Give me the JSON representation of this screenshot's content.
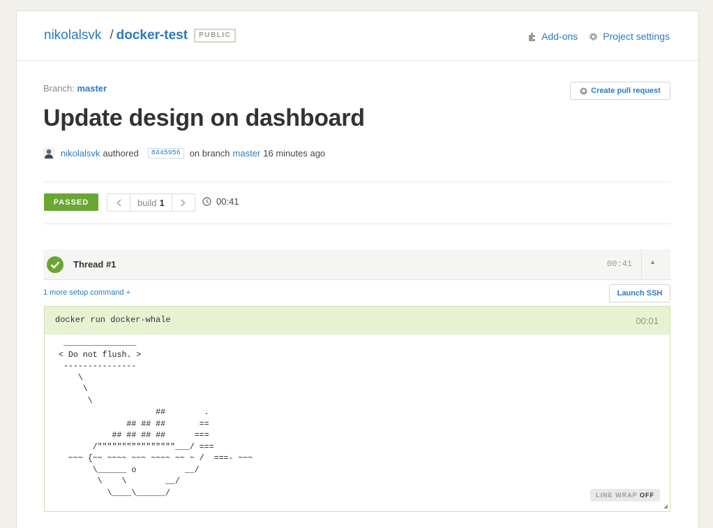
{
  "header": {
    "owner": "nikolalsvk",
    "separator": "/",
    "repo": "docker-test",
    "visibility": "PUBLIC",
    "links": {
      "addons": "Add-ons",
      "settings": "Project settings"
    }
  },
  "build": {
    "branch_label": "Branch:",
    "branch": "master",
    "create_pr": "Create pull request",
    "title": "Update design on dashboard",
    "author": "nikolalsvk",
    "authored": "authored",
    "sha": "8445956",
    "on_branch": "on branch",
    "branch_link": "master",
    "time_ago": "16 minutes ago",
    "status": "PASSED",
    "build_word": "build",
    "build_number": "1",
    "duration": "00:41"
  },
  "thread": {
    "name": "Thread #1",
    "time": "00:41",
    "setup_link": "1 more setup command +",
    "launch_ssh": "Launch SSH"
  },
  "command": {
    "text": "docker run docker-whale",
    "time": "00:01",
    "output": " _______________\n< Do not flush. >\n ---------------\n    \\\n     \\\n      \\\n                    ##        .\n              ## ## ##       ==\n           ## ## ## ##      ===\n       /\"\"\"\"\"\"\"\"\"\"\"\"\"\"\"\"___/ ===\n  ~~~ {~~ ~~~~ ~~~ ~~~~ ~~ ~ /  ===- ~~~\n       \\______ o          __/\n        \\    \\        __/\n          \\____\\______/",
    "line_wrap_label": "LINE WRAP",
    "line_wrap_state": "OFF"
  },
  "colors": {
    "accent": "#2a7bc1",
    "passed": "#6aa632",
    "cmd_header": "#e6f2d2"
  }
}
